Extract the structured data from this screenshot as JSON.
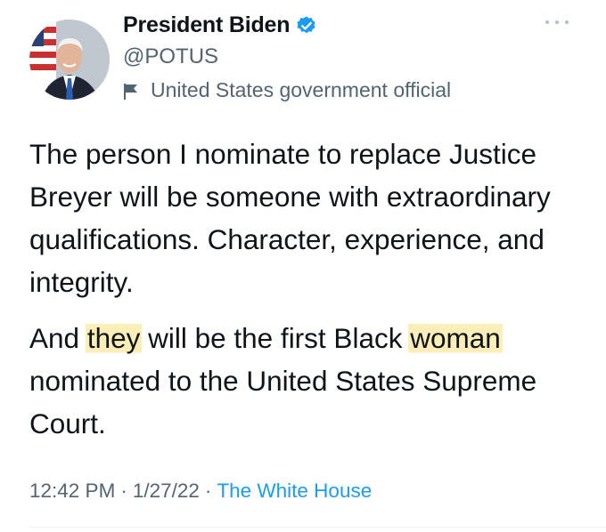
{
  "author": {
    "display_name": "President Biden",
    "handle": "@POTUS",
    "verified": true,
    "label": "United States government official"
  },
  "tweet": {
    "paragraph1": "The person I nominate to replace Justice Breyer will be someone with extraordinary qualifications. Character, experience, and integrity.",
    "paragraph2": {
      "seg1": "And ",
      "highlight1": "they",
      "seg2": " will be the first Black ",
      "highlight2": "woman",
      "seg3": " nominated to the United States Supreme Court."
    },
    "highlight_color": "#fbeeb8"
  },
  "meta": {
    "time": "12:42 PM",
    "separator": "·",
    "date": "1/27/22",
    "source": "The White House"
  },
  "colors": {
    "text": "#0f1419",
    "secondary": "#536471",
    "link": "#1d9bf0",
    "verified": "#1d9bf0"
  },
  "icons": [
    "avatar",
    "verified-badge-icon",
    "flag-icon",
    "more-options-icon"
  ]
}
